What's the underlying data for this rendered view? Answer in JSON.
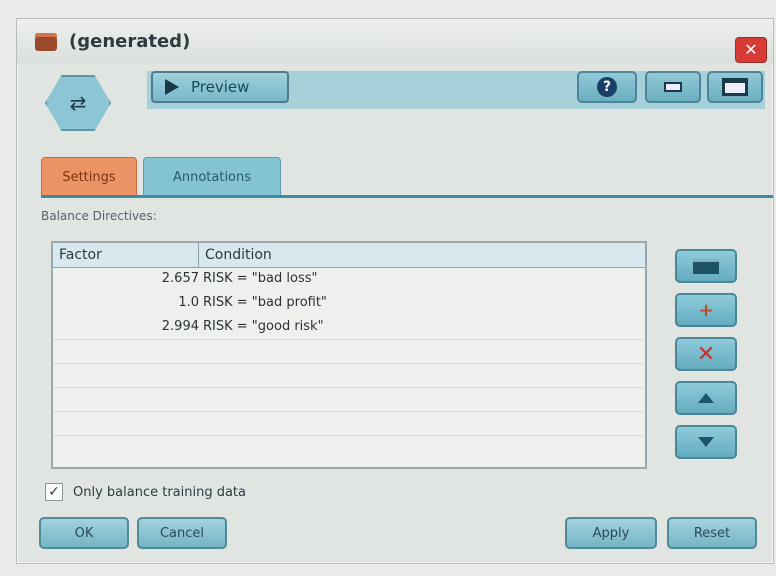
{
  "window": {
    "title": "(generated)"
  },
  "toolbar": {
    "preview_label": "Preview",
    "help_glyph": "?"
  },
  "tabs": [
    {
      "label": "Settings",
      "active": true
    },
    {
      "label": "Annotations",
      "active": false
    }
  ],
  "section_label": "Balance Directives:",
  "table": {
    "columns": [
      "Factor",
      "Condition"
    ],
    "rows": [
      {
        "factor": "2.657",
        "condition": "RISK = \"bad loss\""
      },
      {
        "factor": "1.0",
        "condition": "RISK = \"bad profit\""
      },
      {
        "factor": "2.994",
        "condition": "RISK = \"good risk\""
      }
    ]
  },
  "checkbox": {
    "label": "Only balance training data",
    "checked": true
  },
  "buttons": {
    "ok": "OK",
    "cancel": "Cancel",
    "apply": "Apply",
    "reset": "Reset"
  },
  "icons": {
    "close": "close-icon",
    "help": "help-icon",
    "minimize": "minimize-icon",
    "maximize": "maximize-icon",
    "table_edit": "table-icon",
    "add": "add-icon",
    "delete": "delete-icon",
    "move_up": "arrow-up-icon",
    "move_down": "arrow-down-icon"
  },
  "colors": {
    "accent": "#83c3d2",
    "active_tab": "#ec9466",
    "close": "#d63c35"
  }
}
